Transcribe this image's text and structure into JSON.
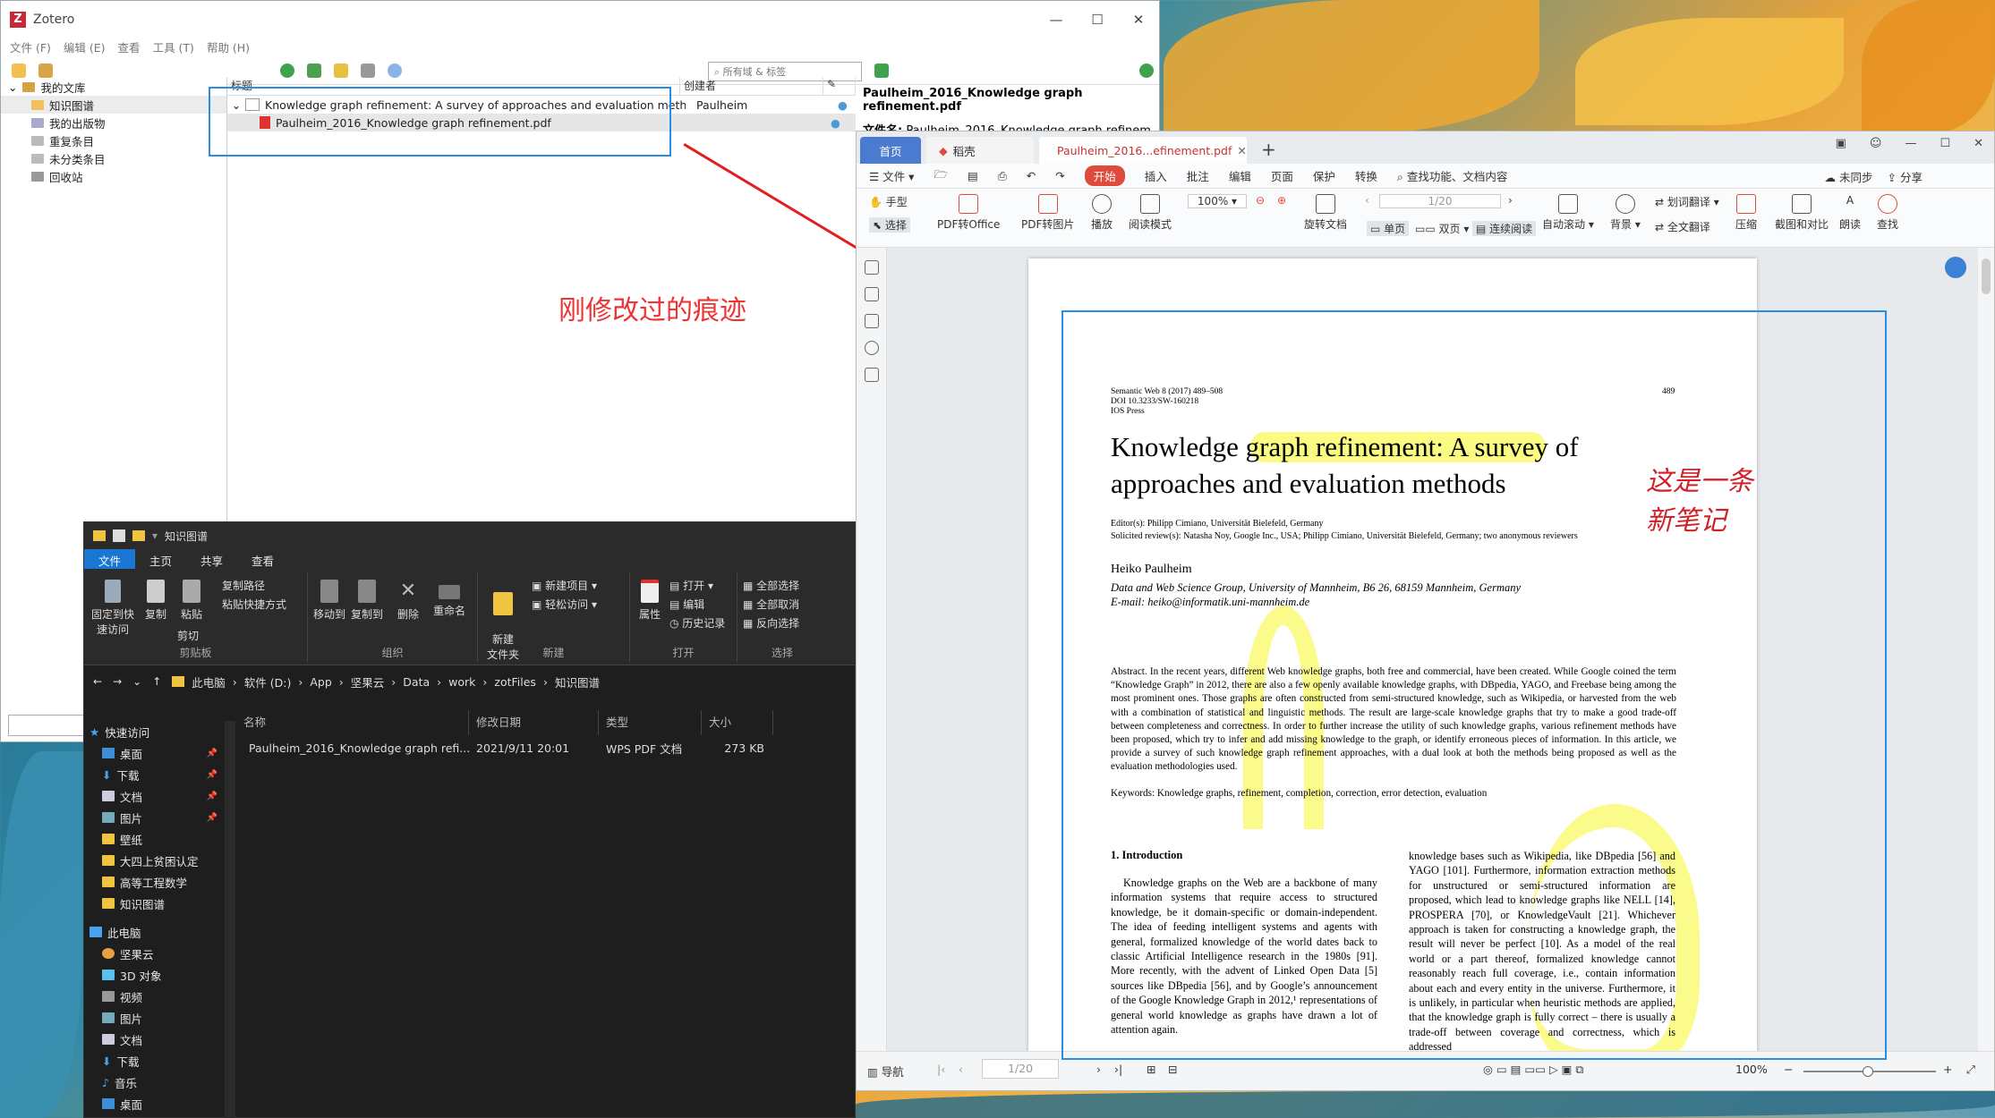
{
  "zotero": {
    "title": "Zotero",
    "window_controls": [
      "—",
      "☐",
      "✕"
    ],
    "menu": [
      "文件 (F)",
      "编辑 (E)",
      "查看",
      "工具 (T)",
      "帮助 (H)"
    ],
    "search_placeholder": "所有域 & 标签",
    "collections": [
      "我的文库",
      "知识图谱",
      "我的出版物",
      "重复条目",
      "未分类条目",
      "回收站"
    ],
    "columns": {
      "title": "标题",
      "creator": "创建者"
    },
    "items": [
      {
        "title": "Knowledge graph refinement: A survey of approaches and evaluation methods",
        "creator": "Paulheim"
      },
      {
        "title": "Paulheim_2016_Knowledge graph refinement.pdf",
        "creator": ""
      }
    ],
    "right_pane": {
      "heading": "Paulheim_2016_Knowledge graph refinement.pdf",
      "file_label": "文件名:",
      "file_value": "Paulheim_2016_Knowledge graph refinem…"
    }
  },
  "annotation": {
    "label": "刚修改过的痕迹",
    "color": "#e8202a",
    "box_color": "#2a8ee0"
  },
  "explorer": {
    "title": "知识图谱",
    "tabs": [
      "文件",
      "主页",
      "共享",
      "查看"
    ],
    "ribbon": {
      "clipboard": {
        "name": "剪贴板",
        "pin": "固定到快速访问",
        "copy": "复制",
        "paste": "粘贴",
        "copy_path": "复制路径",
        "paste_shortcut": "粘贴快捷方式",
        "cut": "剪切"
      },
      "organize": {
        "name": "组织",
        "move_to": "移动到",
        "copy_to": "复制到",
        "delete": "删除",
        "rename": "重命名"
      },
      "new": {
        "name": "新建",
        "new_folder": "新建\n文件夹",
        "new_item": "新建项目",
        "easy_access": "轻松访问"
      },
      "open": {
        "name": "打开",
        "properties": "属性",
        "open": "打开",
        "edit": "编辑",
        "history": "历史记录"
      },
      "select": {
        "name": "选择",
        "select_all": "全部选择",
        "select_none": "全部取消",
        "invert": "反向选择"
      }
    },
    "breadcrumbs": [
      "此电脑",
      "软件 (D:)",
      "App",
      "坚果云",
      "Data",
      "work",
      "zotFiles",
      "知识图谱"
    ],
    "nav": [
      {
        "label": "快速访问",
        "pinned": false
      },
      {
        "label": "桌面",
        "pinned": true
      },
      {
        "label": "下载",
        "pinned": true
      },
      {
        "label": "文档",
        "pinned": true
      },
      {
        "label": "图片",
        "pinned": true
      },
      {
        "label": "壁纸",
        "pinned": false
      },
      {
        "label": "大四上贫困认定",
        "pinned": false
      },
      {
        "label": "高等工程数学",
        "pinned": false
      },
      {
        "label": "知识图谱",
        "pinned": false
      },
      {
        "label": "此电脑",
        "pinned": false
      },
      {
        "label": "坚果云",
        "pinned": false
      },
      {
        "label": "3D 对象",
        "pinned": false
      },
      {
        "label": "视频",
        "pinned": false
      },
      {
        "label": "图片",
        "pinned": false
      },
      {
        "label": "文档",
        "pinned": false
      },
      {
        "label": "下载",
        "pinned": false
      },
      {
        "label": "音乐",
        "pinned": false
      },
      {
        "label": "桌面",
        "pinned": false
      }
    ],
    "columns": [
      "名称",
      "修改日期",
      "类型",
      "大小"
    ],
    "files": [
      {
        "name": "Paulheim_2016_Knowledge graph refi...",
        "date": "2021/9/11 20:01",
        "type": "WPS PDF 文档",
        "size": "273 KB"
      }
    ]
  },
  "wps": {
    "tabs": {
      "home": "首页",
      "straw": "稻壳",
      "doc": "Paulheim_2016...efinement.pdf"
    },
    "menu": [
      "文件",
      "开始",
      "插入",
      "批注",
      "编辑",
      "页面",
      "保护",
      "转换"
    ],
    "search_placeholder": "查找功能、文档内容",
    "right_actions": [
      "未同步",
      "分享"
    ],
    "ribbon": {
      "hand": "手型",
      "select": "选择",
      "pdf_office": "PDF转Office",
      "pdf_image": "PDF转图片",
      "play": "播放",
      "read_mode": "阅读模式",
      "zoom": "100%",
      "page": "1/20",
      "rotate": "旋转文档",
      "single": "单页",
      "double": "双页",
      "continuous": "连续阅读",
      "autoscroll": "自动滚动",
      "background": "背景",
      "word_translate": "划词翻译",
      "full_translate": "全文翻译",
      "compress": "压缩",
      "screenshot": "截图和对比",
      "read_aloud": "朗读",
      "find": "查找"
    },
    "status": {
      "nav": "导航",
      "page": "1/20",
      "zoom": "100%"
    },
    "handwriting": [
      "这是一条",
      "新笔记"
    ],
    "pdf": {
      "header_left": [
        "Semantic Web 8 (2017) 489–508",
        "DOI 10.3233/SW-160218",
        "IOS Press"
      ],
      "page_no": "489",
      "title_line1": "Knowledge graph refinement: A survey of",
      "title_line2": "approaches and evaluation methods",
      "editors": "Editor(s): Philipp Cimiano, Universität Bielefeld, Germany",
      "reviewers": "Solicited review(s): Natasha Noy, Google Inc., USA; Philipp Cimiano, Universität Bielefeld, Germany; two anonymous reviewers",
      "author": "Heiko Paulheim",
      "affiliation": "Data and Web Science Group, University of Mannheim, B6 26, 68159 Mannheim, Germany",
      "email": "E-mail: heiko@informatik.uni-mannheim.de",
      "abstract": "Abstract. In the recent years, different Web knowledge graphs, both free and commercial, have been created. While Google coined the term “Knowledge Graph” in 2012, there are also a few openly available knowledge graphs, with DBpedia, YAGO, and Freebase being among the most prominent ones. Those graphs are often constructed from semi-structured knowledge, such as Wikipedia, or harvested from the web with a combination of statistical and linguistic methods. The result are large-scale knowledge graphs that try to make a good trade-off between completeness and correctness. In order to further increase the utility of such knowledge graphs, various refinement methods have been proposed, which try to infer and add missing knowledge to the graph, or identify erroneous pieces of information. In this article, we provide a survey of such knowledge graph refinement approaches, with a dual look at both the methods being proposed as well as the evaluation methodologies used.",
      "keywords": "Keywords: Knowledge graphs, refinement, completion, correction, error detection, evaluation",
      "section": "1.  Introduction",
      "col_left": "Knowledge graphs on the Web are a backbone of many information systems that require access to structured knowledge, be it domain-specific or domain-independent. The idea of feeding intelligent systems and agents with general, formalized knowledge of the world dates back to classic Artificial Intelligence research in the 1980s [91]. More recently, with the advent of Linked Open Data [5] sources like DBpedia [56], and by Google’s announcement of the Google Knowledge Graph in 2012,¹ representations of general world knowledge as graphs have drawn a lot of attention again.",
      "col_right": "knowledge bases such as Wikipedia, like DBpedia [56] and YAGO [101]. Furthermore, information extraction methods for unstructured or semi-structured information are proposed, which lead to knowledge graphs like NELL [14], PROSPERA [70], or KnowledgeVault [21]. Whichever approach is taken for constructing a knowledge graph, the result will never be perfect [10]. As a model of the real world or a part thereof, formalized knowledge cannot reasonably reach full coverage, i.e., contain information about each and every entity in the universe. Furthermore, it is unlikely, in particular when heuristic methods are applied, that the knowledge graph is fully correct – there is usually a trade-off between coverage and correctness, which is addressed"
    }
  }
}
